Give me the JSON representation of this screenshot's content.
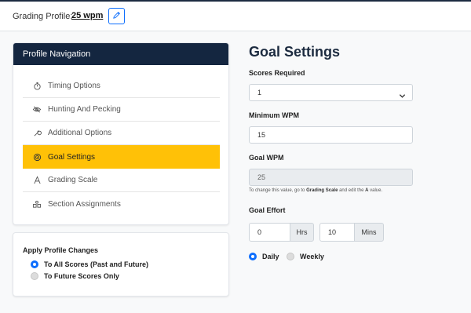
{
  "header": {
    "label": "Grading Profile:",
    "value": "25 wpm"
  },
  "nav": {
    "title": "Profile Navigation",
    "items": [
      {
        "label": "Timing Options",
        "icon": "stopwatch-icon",
        "active": false
      },
      {
        "label": "Hunting And Pecking",
        "icon": "eye-slash-icon",
        "active": false
      },
      {
        "label": "Additional Options",
        "icon": "wrench-icon",
        "active": false
      },
      {
        "label": "Goal Settings",
        "icon": "target-icon",
        "active": true
      },
      {
        "label": "Grading Scale",
        "icon": "letter-a-icon",
        "active": false
      },
      {
        "label": "Section Assignments",
        "icon": "grid-people-icon",
        "active": false
      }
    ]
  },
  "apply": {
    "title": "Apply Profile Changes",
    "options": [
      {
        "label": "To All Scores (Past and Future)",
        "selected": true
      },
      {
        "label": "To Future Scores Only",
        "selected": false
      }
    ]
  },
  "goal": {
    "title": "Goal Settings",
    "scores_label": "Scores Required",
    "scores_value": "1",
    "min_wpm_label": "Minimum WPM",
    "min_wpm_value": "15",
    "goal_wpm_label": "Goal WPM",
    "goal_wpm_value": "25",
    "help_prefix": "To change this value, go to ",
    "help_link": "Grading Scale",
    "help_middle": " and edit the ",
    "help_letter": "A",
    "help_suffix": " value.",
    "effort_label": "Goal Effort",
    "hrs_value": "0",
    "hrs_unit": "Hrs",
    "mins_value": "10",
    "mins_unit": "Mins",
    "periods": [
      {
        "label": "Daily",
        "selected": true
      },
      {
        "label": "Weekly",
        "selected": false
      }
    ]
  },
  "colors": {
    "accent": "#0d6efd",
    "active_nav": "#ffc107",
    "nav_header": "#142640"
  }
}
